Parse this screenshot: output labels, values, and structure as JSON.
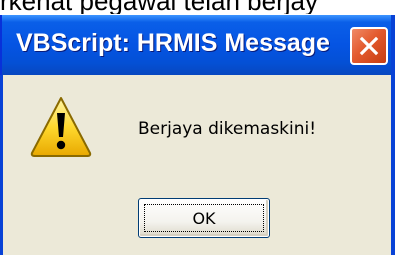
{
  "background": {
    "partial_text": "rkehat pegawai telah berjay"
  },
  "dialog": {
    "title": "VBScript: HRMIS Message",
    "message": "Berjaya dikemaskini!",
    "ok_label": "OK",
    "icon": "warning-icon",
    "close_icon": "close-icon"
  },
  "colors": {
    "titlebar": "#0554e3",
    "dialog_bg": "#ece9d8",
    "close_button": "#e35a2e"
  }
}
